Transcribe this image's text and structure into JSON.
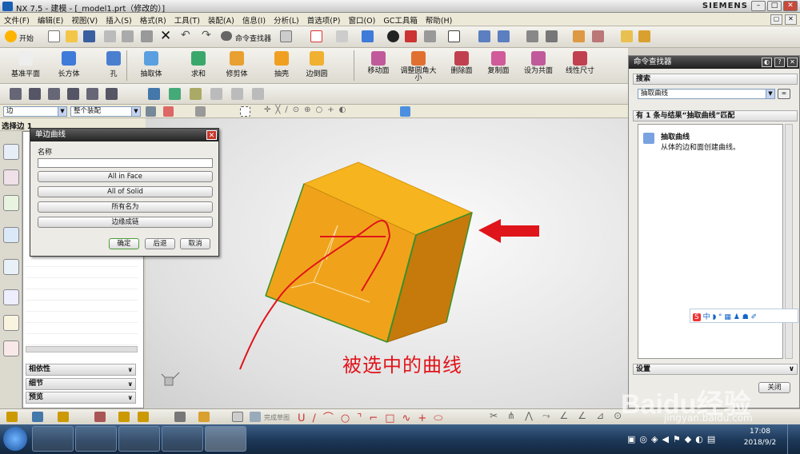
{
  "window": {
    "title": "NX 7.5 - 建模 - [_model1.prt（修改的）]",
    "brand": "SIEMENS"
  },
  "menubar": [
    "文件(F)",
    "编辑(E)",
    "视图(V)",
    "插入(S)",
    "格式(R)",
    "工具(T)",
    "装配(A)",
    "信息(I)",
    "分析(L)",
    "首选项(P)",
    "窗口(O)",
    "GC工具箱",
    "帮助(H)"
  ],
  "standard_toolbar": {
    "start": "开始",
    "command_finder": "命令查找器"
  },
  "feature_toolbar": [
    {
      "label": "基准平面",
      "icon": "datum-plane-icon"
    },
    {
      "label": "长方体",
      "icon": "block-icon"
    },
    {
      "label": "孔",
      "icon": "hole-icon"
    },
    {
      "label": "抽取体",
      "icon": "extract-body-icon"
    },
    {
      "label": "求和",
      "icon": "unite-icon"
    },
    {
      "label": "修剪体",
      "icon": "trim-body-icon"
    },
    {
      "label": "抽壳",
      "icon": "shell-icon"
    },
    {
      "label": "边倒圆",
      "icon": "edge-blend-icon"
    }
  ],
  "sync_toolbar": [
    {
      "label": "移动面",
      "icon": "move-face-icon"
    },
    {
      "label": "调整圆角大小",
      "icon": "resize-blend-icon"
    },
    {
      "label": "删除面",
      "icon": "delete-face-icon"
    },
    {
      "label": "复制面",
      "icon": "copy-face-icon"
    },
    {
      "label": "设为共面",
      "icon": "make-coplanar-icon"
    },
    {
      "label": "线性尺寸",
      "icon": "linear-dimension-icon"
    }
  ],
  "selection_bar": {
    "filter": "边",
    "scope": "整个装配"
  },
  "prompt": "选择边 1",
  "left_panel": {
    "sections": [
      "相依性",
      "细节",
      "预览"
    ]
  },
  "dialog": {
    "title": "单边曲线",
    "name_label": "名称",
    "name_value": "",
    "buttons": [
      "All in Face",
      "All of Solid",
      "所有名为",
      "边缘成链"
    ],
    "ok": "确定",
    "back": "后退",
    "cancel": "取消"
  },
  "annotation": "被选中的曲线",
  "command_finder_panel": {
    "title": "命令查找器",
    "search_header": "搜索",
    "search_value": "抽取曲线",
    "results_header": "有 1 条与结果“抽取曲线”匹配",
    "result_title": "抽取曲线",
    "result_desc": "从体的边和面创建曲线。",
    "settings": "设置",
    "close": "关闭"
  },
  "sketch_toolbar": {
    "finish_sketch": "完成草图"
  },
  "taskbar": {
    "time": "17:08",
    "date": "2018/9/2"
  },
  "watermark": {
    "brand": "Baidu经验",
    "url": "jingyan.baidu.com"
  },
  "colors": {
    "cube_top": "#f6b51e",
    "cube_front": "#f0a31a",
    "cube_side": "#c67a0c",
    "annotation_red": "#e0141b"
  }
}
